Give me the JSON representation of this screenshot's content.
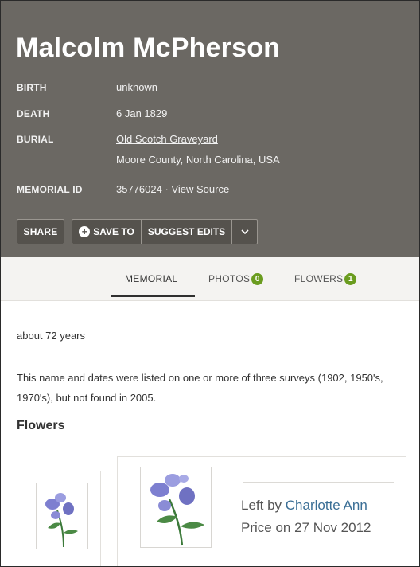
{
  "memorial": {
    "name": "Malcolm McPherson",
    "facts": {
      "birth_label": "BIRTH",
      "birth_value": "unknown",
      "death_label": "DEATH",
      "death_value": "6 Jan 1829",
      "burial_label": "BURIAL",
      "burial_place": "Old Scotch Graveyard",
      "burial_location": "Moore County, North Carolina, USA",
      "id_label": "MEMORIAL ID",
      "id_value": "35776024",
      "id_separator": "·",
      "view_source": "View Source"
    }
  },
  "actions": {
    "share": "SHARE",
    "save_to": "SAVE TO",
    "suggest_edits": "SUGGEST EDITS",
    "more_icon": "chevron-down-icon"
  },
  "tabs": {
    "memorial": "MEMORIAL",
    "photos": "PHOTOS",
    "photos_count": "0",
    "flowers": "FLOWERS",
    "flowers_count": "1"
  },
  "content": {
    "age": "about 72 years",
    "bio_line1": "This name and dates were listed on one or more of three surveys (1902, 1950's,",
    "bio_line2": "1970's), but not found in 2005.",
    "flowers_title": "Flowers"
  },
  "flower_entry": {
    "left_by_prefix": "Left by",
    "author": "Charlotte Ann",
    "date_line": "Price on 27 Nov 2012"
  },
  "colors": {
    "header_bg": "#6b6863",
    "badge_green": "#6a9c1f",
    "link_blue": "#3b6f96"
  }
}
